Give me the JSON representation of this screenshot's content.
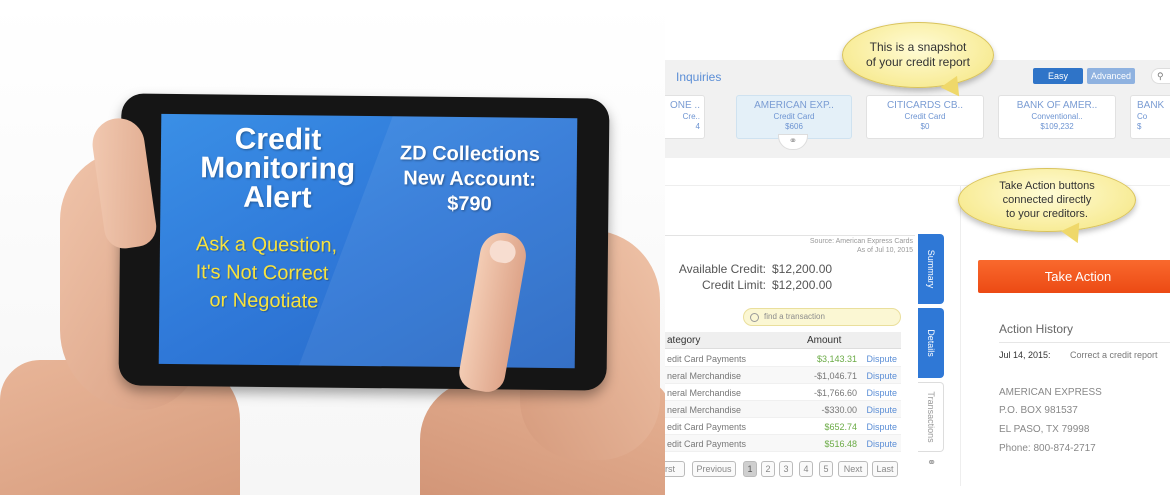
{
  "tablet": {
    "headline": [
      "Credit",
      "Monitoring",
      "Alert"
    ],
    "alert_lines": [
      "ZD Collections",
      "New Account:",
      "$790"
    ],
    "cta_lines": [
      "Ask a Question,",
      "It's Not Correct",
      "or  Negotiate"
    ]
  },
  "callouts": {
    "snapshot": [
      "This is a snapshot",
      "of your credit report"
    ],
    "take_action": [
      "Take Action buttons",
      "connected directly",
      "to your creditors."
    ]
  },
  "app": {
    "section_label": "Inquiries",
    "mode_easy": "Easy",
    "mode_advanced": "Advanced",
    "search_icon": "search-icon",
    "accounts": [
      {
        "name": "ONE ..",
        "type": "Cre..",
        "amount": "4"
      },
      {
        "name": "AMERICAN EXP..",
        "type": "Credit Card",
        "amount": "$606",
        "selected": true
      },
      {
        "name": "CITICARDS CB..",
        "type": "Credit Card",
        "amount": "$0"
      },
      {
        "name": "BANK OF AMER..",
        "type": "Conventional..",
        "amount": "$109,232"
      },
      {
        "name": "BANK",
        "type": "Co",
        "amount": "$"
      }
    ],
    "source_lines": [
      "Source: American Express Cards",
      "As of Jul 10, 2015"
    ],
    "available_credit_label": "Available Credit:",
    "available_credit_value": "$12,200.00",
    "credit_limit_label": "Credit Limit:",
    "credit_limit_value": "$12,200.00",
    "find_placeholder": "find a transaction",
    "table": {
      "col_category": "ategory",
      "col_amount": "Amount",
      "rows": [
        {
          "category": "edit Card Payments",
          "amount": "$3,143.31",
          "positive": true,
          "action": "Dispute"
        },
        {
          "category": "neral Merchandise",
          "amount": "-$1,046.71",
          "positive": false,
          "action": "Dispute"
        },
        {
          "category": "neral Merchandise",
          "amount": "-$1,766.60",
          "positive": false,
          "action": "Dispute"
        },
        {
          "category": "neral Merchandise",
          "amount": "-$330.00",
          "positive": false,
          "action": "Dispute"
        },
        {
          "category": "edit Card Payments",
          "amount": "$652.74",
          "positive": true,
          "action": "Dispute"
        },
        {
          "category": "edit Card Payments",
          "amount": "$516.48",
          "positive": true,
          "action": "Dispute"
        }
      ]
    },
    "pager": {
      "first": "rst",
      "previous": "Previous",
      "pages": [
        "1",
        "2",
        "3",
        "4",
        "5"
      ],
      "current": "1",
      "next": "Next",
      "last": "Last"
    },
    "side_tabs": [
      "Summary",
      "Details",
      "Transactions"
    ],
    "take_action_label": "Take Action",
    "action_history_title": "Action History",
    "history_date": "Jul 14, 2015:",
    "history_desc": "Correct a credit report",
    "creditor_address": [
      "AMERICAN EXPRESS",
      "P.O. BOX 981537",
      "EL PASO, TX 79998",
      "Phone: 800-874-2717"
    ],
    "colors": {
      "primary_blue": "#2f78d6",
      "take_action_orange": "#f15a22",
      "positive_green": "#6bab46",
      "callout_yellow": "#f8ec98"
    }
  }
}
